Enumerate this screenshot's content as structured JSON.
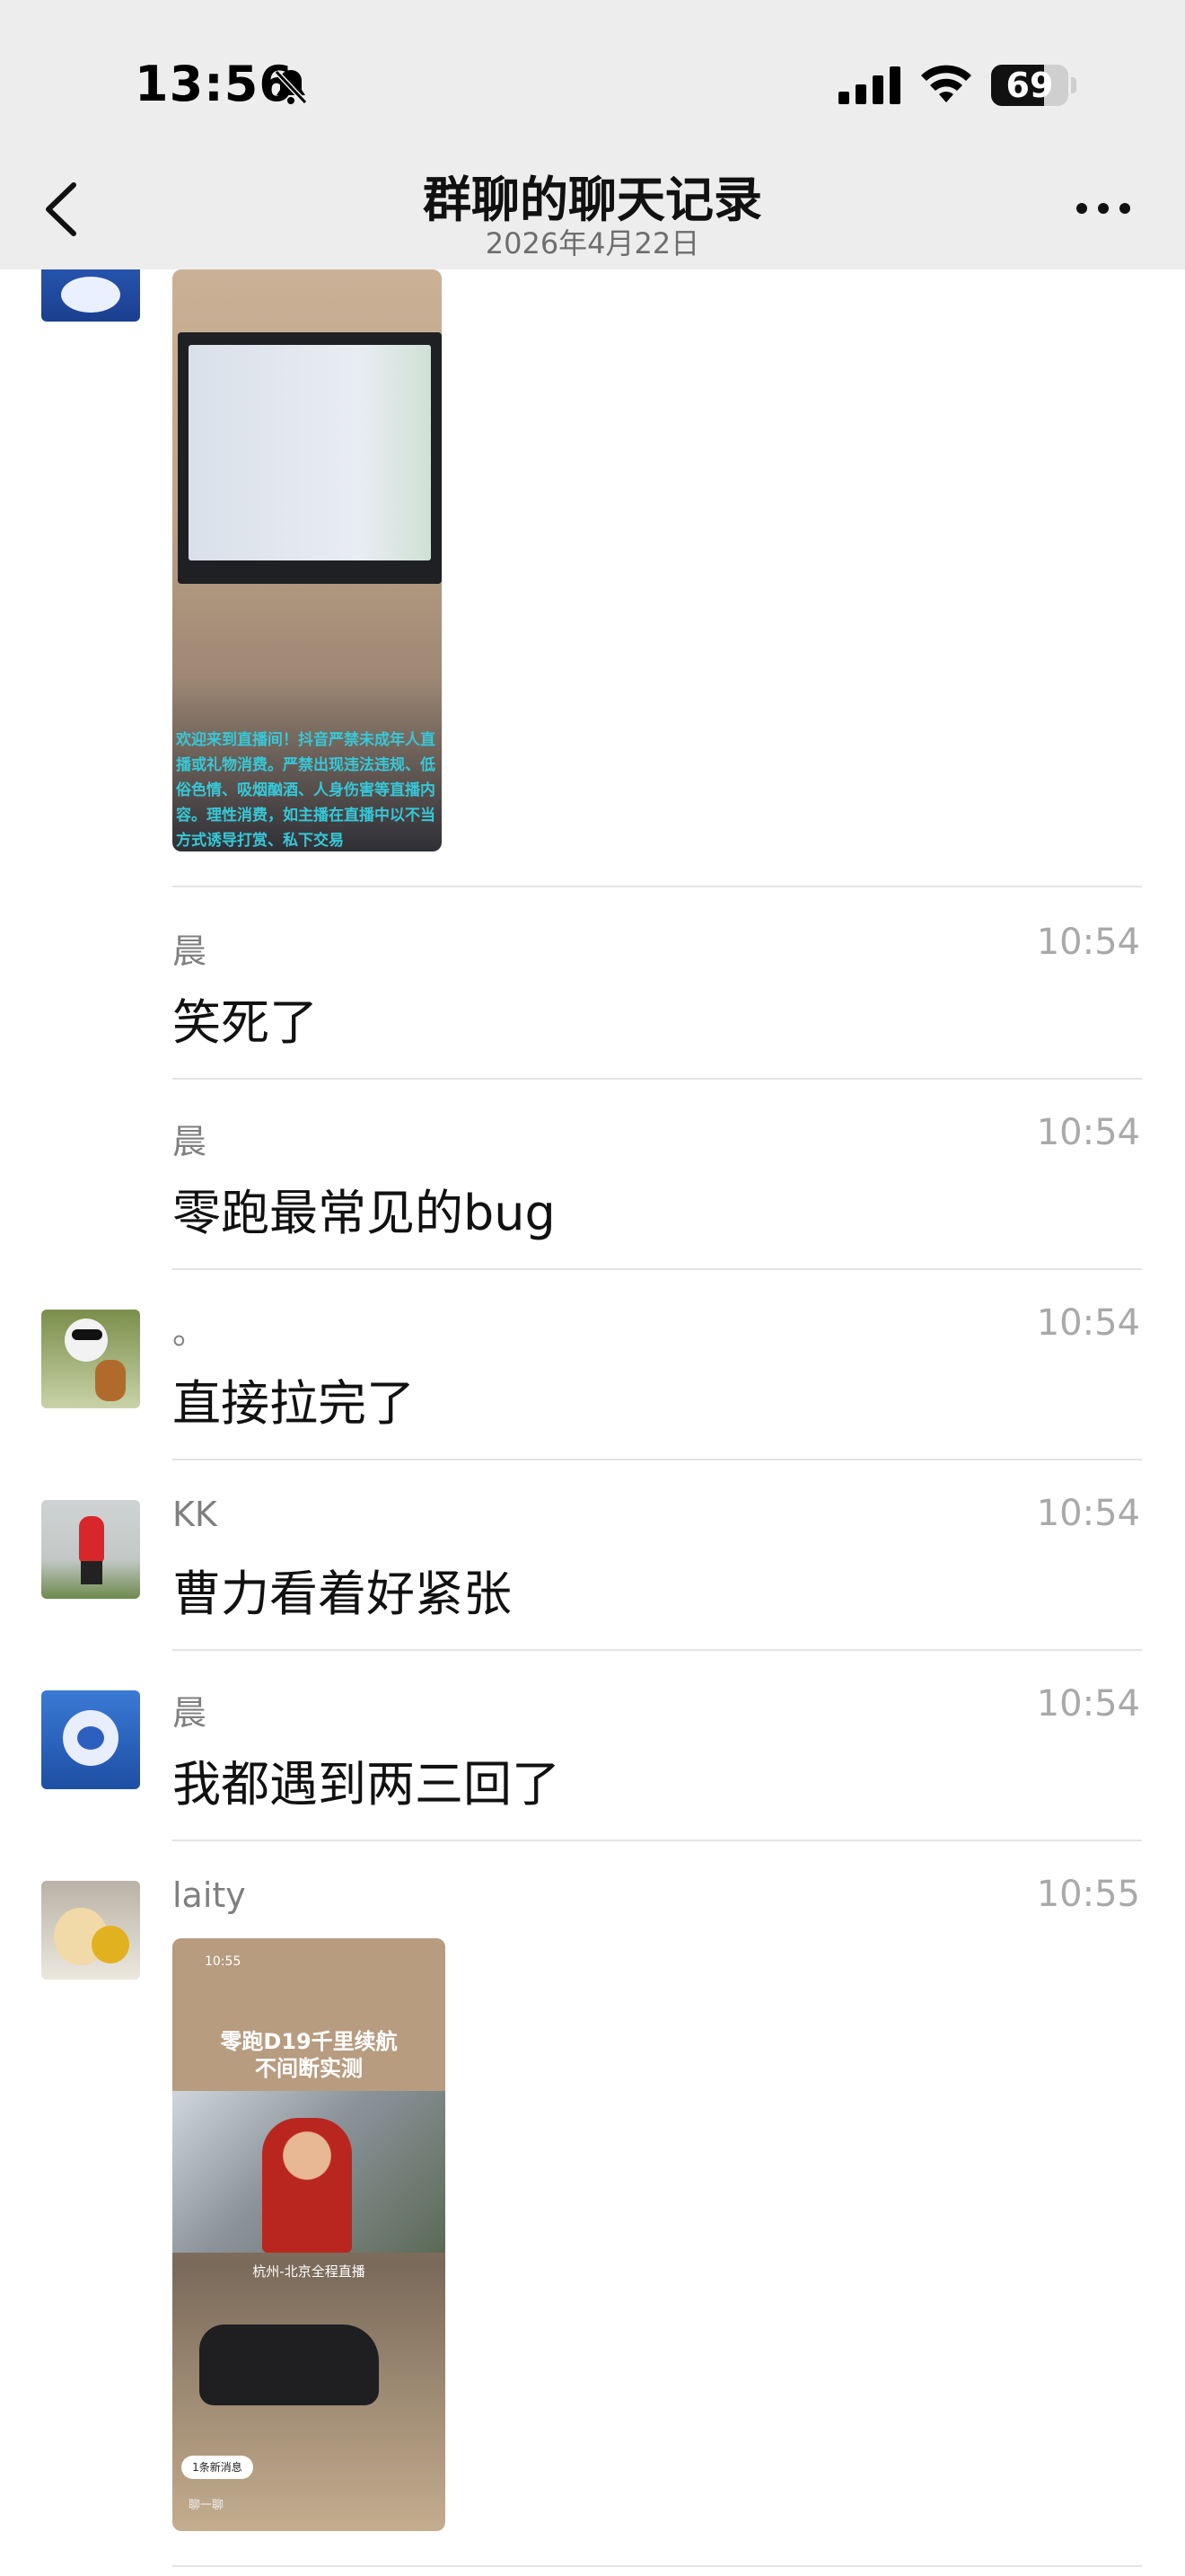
{
  "status_bar": {
    "time": "13:56",
    "battery": "69",
    "icons": [
      "bell-slash-icon",
      "signal-icon",
      "wifi-icon",
      "battery-icon"
    ]
  },
  "nav": {
    "title": "群聊的聊天记录",
    "subtitle": "2026年4月22日",
    "back_icon": "chevron-left-icon",
    "more_icon": "more-dots-icon"
  },
  "messages": [
    {
      "sender": "晨",
      "time": "10:54",
      "text": "笑死了"
    },
    {
      "sender": "晨",
      "time": "10:54",
      "text": "零跑最常见的bug"
    },
    {
      "sender": "。",
      "time": "10:54",
      "text": "直接拉完了"
    },
    {
      "sender": "KK",
      "time": "10:54",
      "text": "曹力看着好紧张"
    },
    {
      "sender": "晨",
      "time": "10:54",
      "text": "我都遇到两三回了"
    },
    {
      "sender": "laity",
      "time": "10:55",
      "image": {
        "status_time": "10:55",
        "title_line1": "零跑D19千里续航",
        "title_line2": "不间断实测",
        "location": "杭州-北京全程直播",
        "badge": "1条新消息",
        "input_hint": "聊一聊"
      }
    }
  ],
  "first_image": {
    "caption": "欢迎来到直播间！抖音严禁未成年人直播或礼物消费。严禁出现违法违规、低俗色情、吸烟酗酒、人身伤害等直播内容。理性消费，如主播在直播中以不当方式诱导打赏、私下交易"
  }
}
